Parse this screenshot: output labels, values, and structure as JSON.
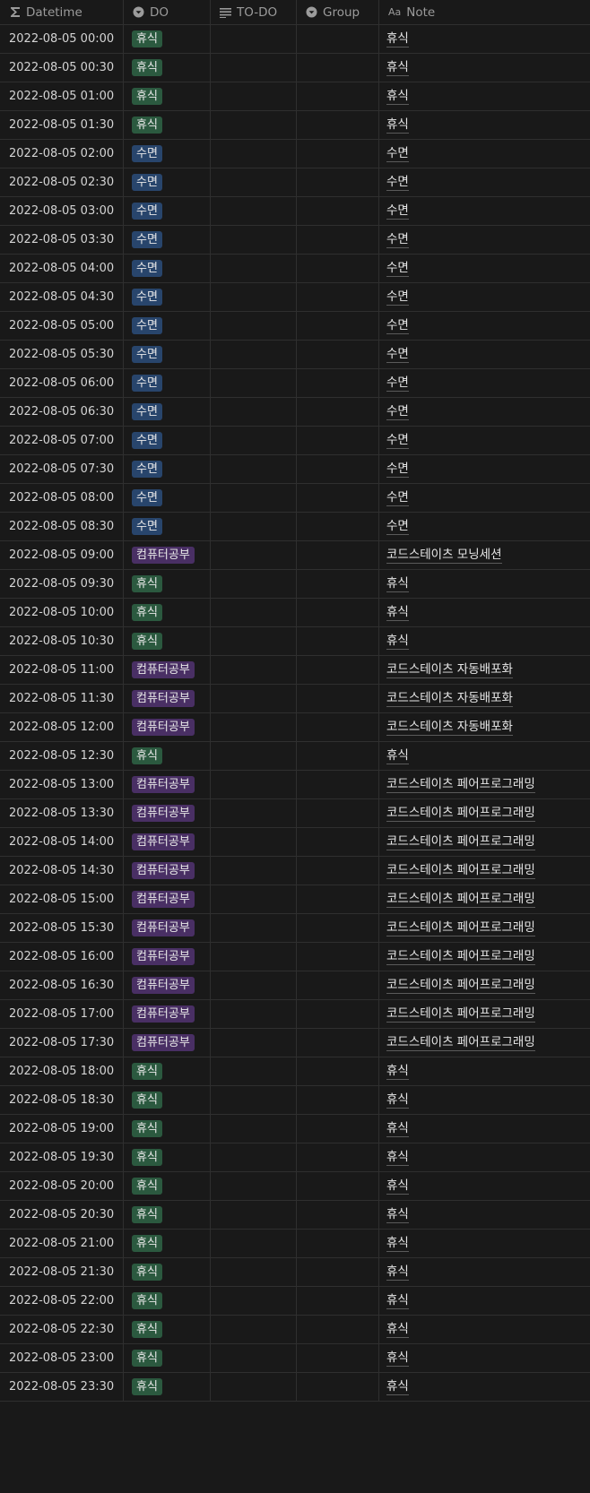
{
  "headers": {
    "datetime": "Datetime",
    "do": "DO",
    "todo": "TO-DO",
    "group": "Group",
    "note": "Note",
    "note_icon_text": "Aa"
  },
  "colors": {
    "rest": "#2b593f",
    "sleep": "#28456c",
    "study": "#492f64"
  },
  "tag_kinds": {
    "휴식": "rest",
    "수면": "sleep",
    "컴퓨터공부": "study"
  },
  "rows": [
    {
      "datetime": "2022-08-05 00:00",
      "do": "휴식",
      "note": "휴식"
    },
    {
      "datetime": "2022-08-05 00:30",
      "do": "휴식",
      "note": "휴식"
    },
    {
      "datetime": "2022-08-05 01:00",
      "do": "휴식",
      "note": "휴식"
    },
    {
      "datetime": "2022-08-05 01:30",
      "do": "휴식",
      "note": "휴식"
    },
    {
      "datetime": "2022-08-05 02:00",
      "do": "수면",
      "note": "수면"
    },
    {
      "datetime": "2022-08-05 02:30",
      "do": "수면",
      "note": "수면"
    },
    {
      "datetime": "2022-08-05 03:00",
      "do": "수면",
      "note": "수면"
    },
    {
      "datetime": "2022-08-05 03:30",
      "do": "수면",
      "note": "수면"
    },
    {
      "datetime": "2022-08-05 04:00",
      "do": "수면",
      "note": "수면"
    },
    {
      "datetime": "2022-08-05 04:30",
      "do": "수면",
      "note": "수면"
    },
    {
      "datetime": "2022-08-05 05:00",
      "do": "수면",
      "note": "수면"
    },
    {
      "datetime": "2022-08-05 05:30",
      "do": "수면",
      "note": "수면"
    },
    {
      "datetime": "2022-08-05 06:00",
      "do": "수면",
      "note": "수면"
    },
    {
      "datetime": "2022-08-05 06:30",
      "do": "수면",
      "note": "수면"
    },
    {
      "datetime": "2022-08-05 07:00",
      "do": "수면",
      "note": "수면"
    },
    {
      "datetime": "2022-08-05 07:30",
      "do": "수면",
      "note": "수면"
    },
    {
      "datetime": "2022-08-05 08:00",
      "do": "수면",
      "note": "수면"
    },
    {
      "datetime": "2022-08-05 08:30",
      "do": "수면",
      "note": "수면"
    },
    {
      "datetime": "2022-08-05 09:00",
      "do": "컴퓨터공부",
      "note": "코드스테이츠 모닝세션"
    },
    {
      "datetime": "2022-08-05 09:30",
      "do": "휴식",
      "note": "휴식"
    },
    {
      "datetime": "2022-08-05 10:00",
      "do": "휴식",
      "note": "휴식"
    },
    {
      "datetime": "2022-08-05 10:30",
      "do": "휴식",
      "note": "휴식"
    },
    {
      "datetime": "2022-08-05 11:00",
      "do": "컴퓨터공부",
      "note": "코드스테이츠 자동배포화"
    },
    {
      "datetime": "2022-08-05 11:30",
      "do": "컴퓨터공부",
      "note": "코드스테이츠 자동배포화"
    },
    {
      "datetime": "2022-08-05 12:00",
      "do": "컴퓨터공부",
      "note": "코드스테이츠 자동배포화"
    },
    {
      "datetime": "2022-08-05 12:30",
      "do": "휴식",
      "note": "휴식"
    },
    {
      "datetime": "2022-08-05 13:00",
      "do": "컴퓨터공부",
      "note": "코드스테이츠 페어프로그래밍"
    },
    {
      "datetime": "2022-08-05 13:30",
      "do": "컴퓨터공부",
      "note": "코드스테이츠 페어프로그래밍"
    },
    {
      "datetime": "2022-08-05 14:00",
      "do": "컴퓨터공부",
      "note": "코드스테이츠 페어프로그래밍"
    },
    {
      "datetime": "2022-08-05 14:30",
      "do": "컴퓨터공부",
      "note": "코드스테이츠 페어프로그래밍"
    },
    {
      "datetime": "2022-08-05 15:00",
      "do": "컴퓨터공부",
      "note": "코드스테이츠 페어프로그래밍"
    },
    {
      "datetime": "2022-08-05 15:30",
      "do": "컴퓨터공부",
      "note": "코드스테이츠 페어프로그래밍"
    },
    {
      "datetime": "2022-08-05 16:00",
      "do": "컴퓨터공부",
      "note": "코드스테이츠 페어프로그래밍"
    },
    {
      "datetime": "2022-08-05 16:30",
      "do": "컴퓨터공부",
      "note": "코드스테이츠 페어프로그래밍"
    },
    {
      "datetime": "2022-08-05 17:00",
      "do": "컴퓨터공부",
      "note": "코드스테이츠 페어프로그래밍"
    },
    {
      "datetime": "2022-08-05 17:30",
      "do": "컴퓨터공부",
      "note": "코드스테이츠 페어프로그래밍"
    },
    {
      "datetime": "2022-08-05 18:00",
      "do": "휴식",
      "note": "휴식"
    },
    {
      "datetime": "2022-08-05 18:30",
      "do": "휴식",
      "note": "휴식"
    },
    {
      "datetime": "2022-08-05 19:00",
      "do": "휴식",
      "note": "휴식"
    },
    {
      "datetime": "2022-08-05 19:30",
      "do": "휴식",
      "note": "휴식"
    },
    {
      "datetime": "2022-08-05 20:00",
      "do": "휴식",
      "note": "휴식"
    },
    {
      "datetime": "2022-08-05 20:30",
      "do": "휴식",
      "note": "휴식"
    },
    {
      "datetime": "2022-08-05 21:00",
      "do": "휴식",
      "note": "휴식"
    },
    {
      "datetime": "2022-08-05 21:30",
      "do": "휴식",
      "note": "휴식"
    },
    {
      "datetime": "2022-08-05 22:00",
      "do": "휴식",
      "note": "휴식"
    },
    {
      "datetime": "2022-08-05 22:30",
      "do": "휴식",
      "note": "휴식"
    },
    {
      "datetime": "2022-08-05 23:00",
      "do": "휴식",
      "note": "휴식"
    },
    {
      "datetime": "2022-08-05 23:30",
      "do": "휴식",
      "note": "휴식"
    }
  ]
}
